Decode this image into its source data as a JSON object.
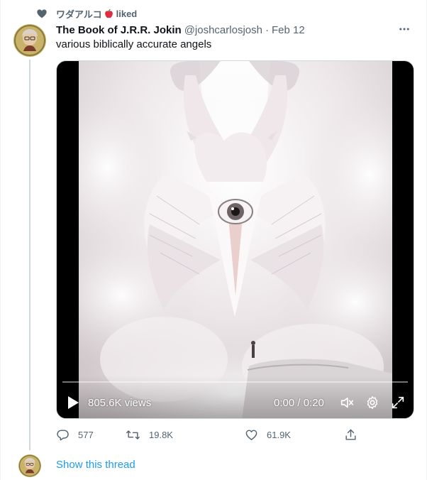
{
  "social_context": {
    "name": "ワダアルコ",
    "action": "liked"
  },
  "tweet": {
    "display_name": "The Book of J.R.R. Jokin",
    "handle": "@joshcarlosjosh",
    "separator": "·",
    "date": "Feb 12",
    "text": "various biblically accurate angels"
  },
  "video": {
    "views": "805.6K views",
    "time": "0:00 / 0:20",
    "progress": 0
  },
  "actions": {
    "replies": "577",
    "retweets": "19.8K",
    "likes": "61.9K"
  },
  "thread": {
    "show_label": "Show this thread"
  },
  "colors": {
    "text_primary": "#0f1419",
    "text_secondary": "#536471",
    "link": "#1d9bf0",
    "border": "#cfd9de"
  }
}
